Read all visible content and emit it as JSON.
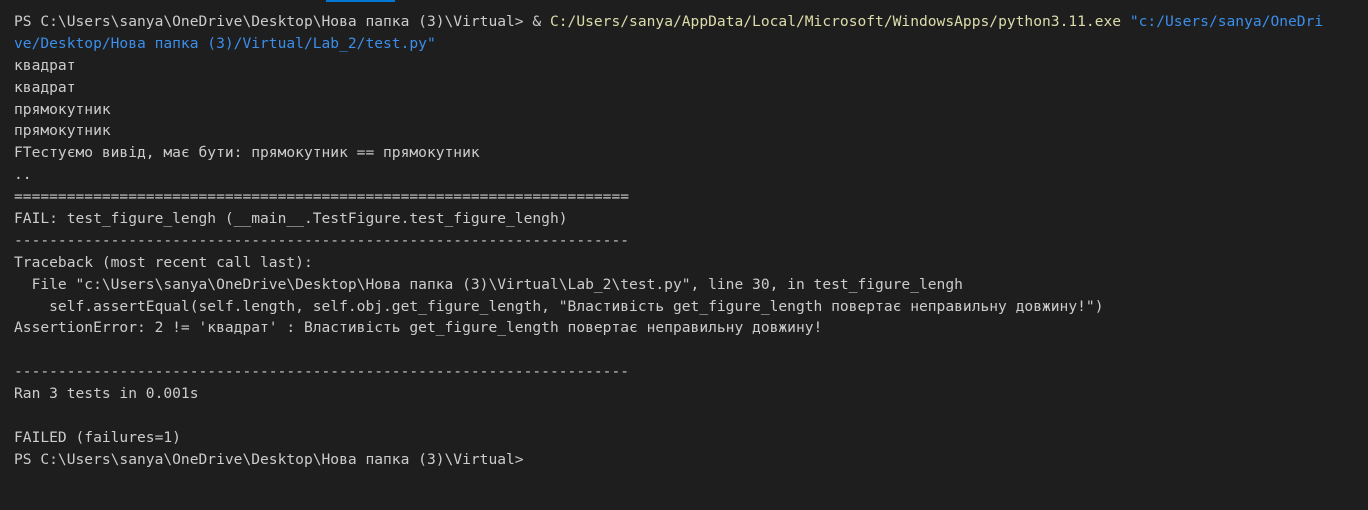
{
  "terminal": {
    "prompt1": "PS C:\\Users\\sanya\\OneDrive\\Desktop\\Нова папка (3)\\Virtual> ",
    "amp": "& ",
    "exe_path": "C:/Users/sanya/AppData/Local/Microsoft/WindowsApps/python3.11.exe",
    "arg_part1": " \"c:/Users/sanya/OneDri",
    "arg_part2": "ve/Desktop/Нова папка (3)/Virtual/Lab_2/test.py\"",
    "lines": [
      "квадрат",
      "квадрат",
      "прямокутник",
      "прямокутник",
      "FТестуємо вивід, має бути: прямокутник == прямокутник",
      "..",
      "======================================================================",
      "FAIL: test_figure_lengh (__main__.TestFigure.test_figure_lengh)",
      "----------------------------------------------------------------------",
      "Traceback (most recent call last):",
      "  File \"c:\\Users\\sanya\\OneDrive\\Desktop\\Нова папка (3)\\Virtual\\Lab_2\\test.py\", line 30, in test_figure_lengh",
      "    self.assertEqual(self.length, self.obj.get_figure_length, \"Властивість get_figure_length повертає неправильну довжину!\")",
      "AssertionError: 2 != 'квадрат' : Властивість get_figure_length повертає неправильну довжину!",
      "",
      "----------------------------------------------------------------------",
      "Ran 3 tests in 0.001s",
      "",
      "FAILED (failures=1)",
      "PS C:\\Users\\sanya\\OneDrive\\Desktop\\Нова папка (3)\\Virtual>"
    ]
  }
}
